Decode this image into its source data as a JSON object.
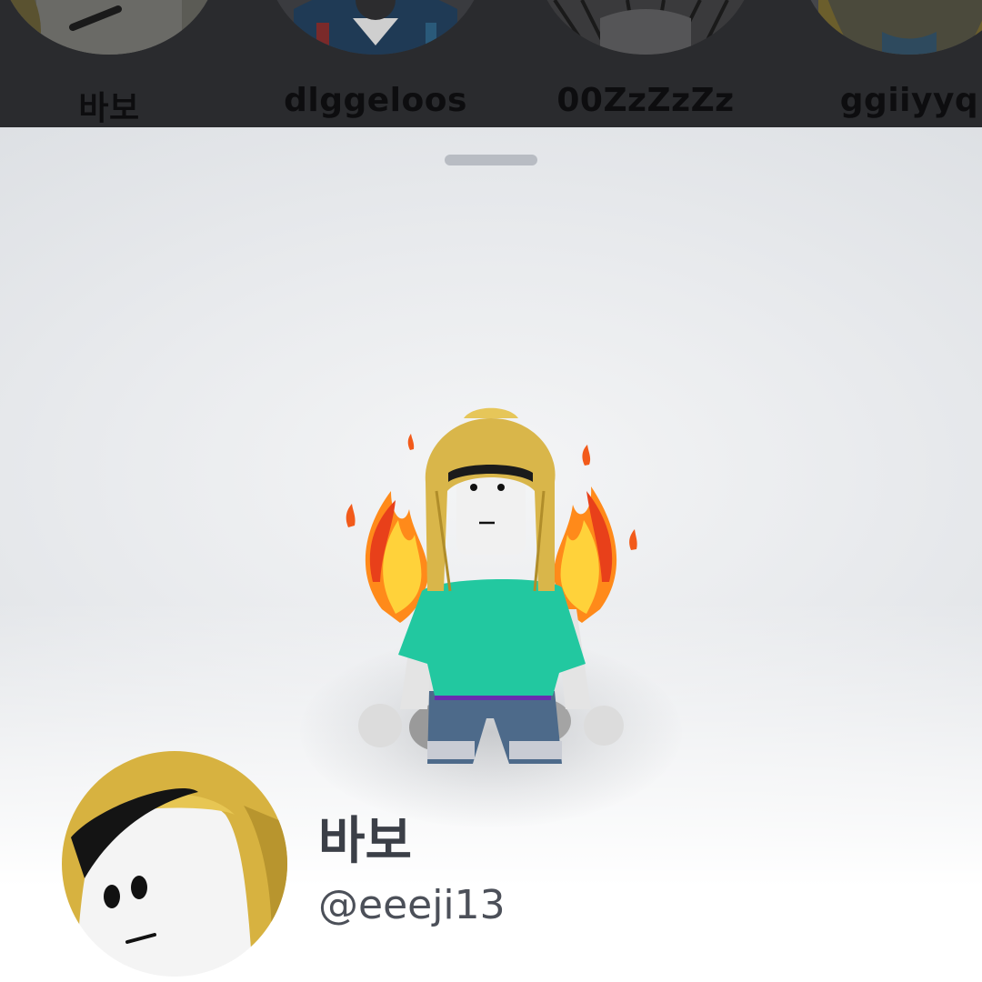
{
  "friends": [
    {
      "name": "바보"
    },
    {
      "name": "dlggeloos"
    },
    {
      "name": "00ZzZzZz"
    },
    {
      "name": "ggiiyyq"
    }
  ],
  "profile": {
    "display_name": "바보",
    "username": "@eeeji13"
  },
  "colors": {
    "strip_background": "#2a2b2e",
    "text_primary": "#3b3f47",
    "text_secondary": "#4c5059",
    "handle": "#b8bcc3"
  }
}
